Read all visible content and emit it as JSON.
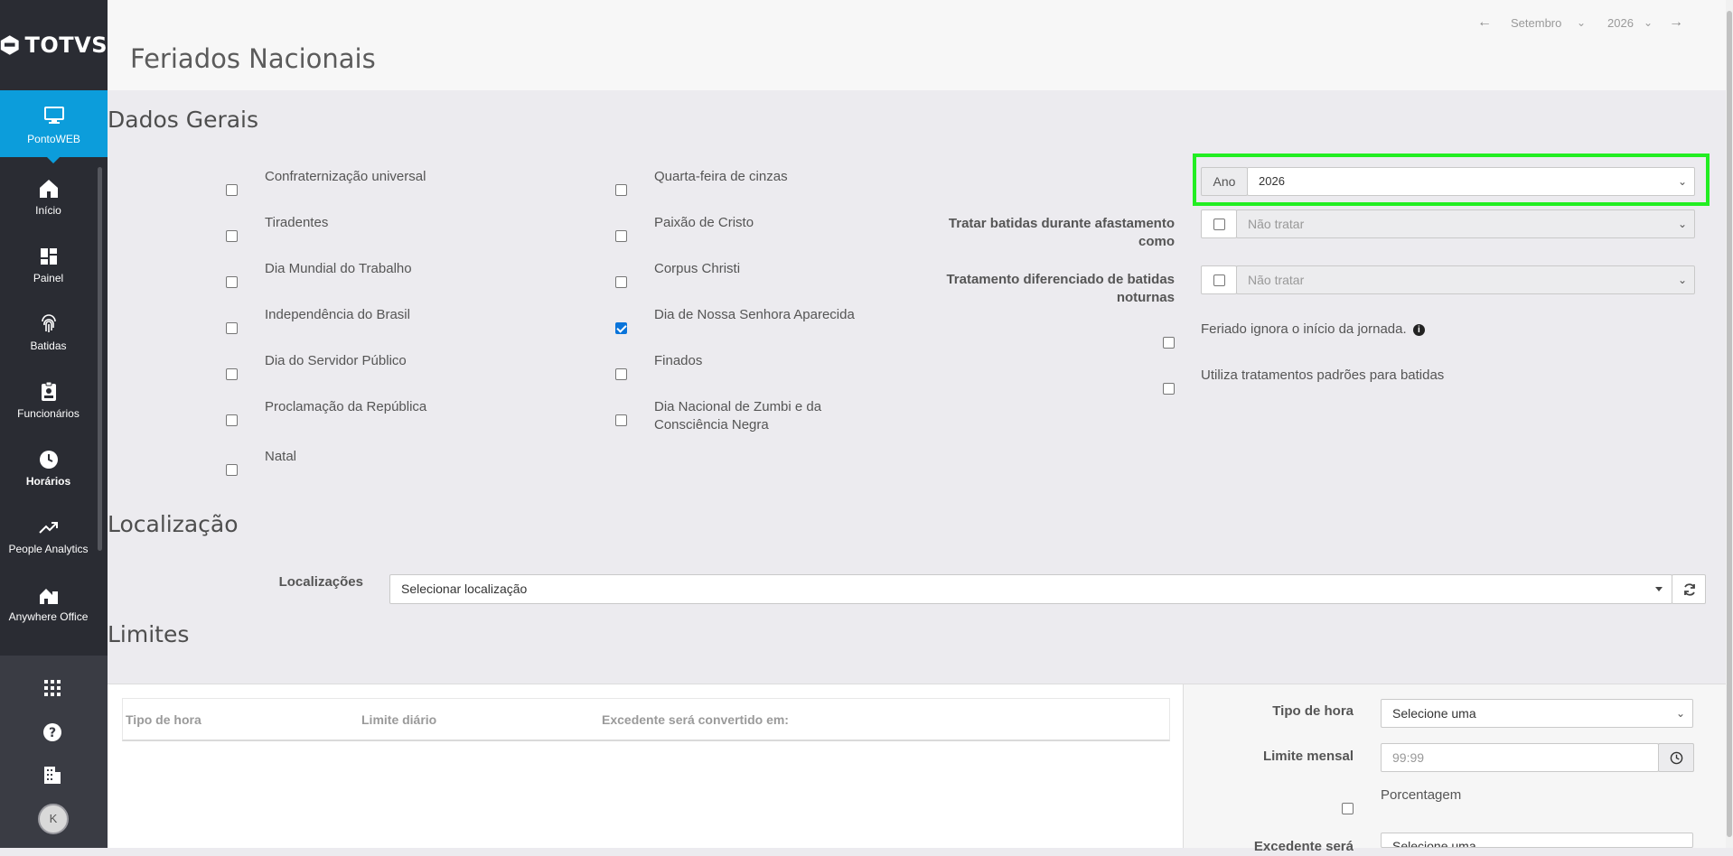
{
  "sidebar": {
    "logo": "TOTVS",
    "active": "PontoWEB",
    "items": [
      {
        "label": "Início",
        "icon": "home-icon"
      },
      {
        "label": "Painel",
        "icon": "dashboard-icon"
      },
      {
        "label": "Batidas",
        "icon": "fingerprint-icon"
      },
      {
        "label": "Funcionários",
        "icon": "id-badge-icon"
      },
      {
        "label": "Horários",
        "icon": "clock-icon"
      },
      {
        "label": "People Analytics",
        "icon": "trending-up-icon"
      },
      {
        "label": "Anywhere Office",
        "icon": "house-building-icon"
      }
    ],
    "bottom": [
      "apps-grid-icon",
      "help-icon",
      "building-icon"
    ],
    "avatar": "K"
  },
  "header": {
    "title": "Feriados Nacionais",
    "month": "Setembro",
    "year": "2026"
  },
  "dados_gerais": {
    "title": "Dados Gerais",
    "col1": [
      {
        "label": "Confraternização universal",
        "checked": false
      },
      {
        "label": "Tiradentes",
        "checked": false
      },
      {
        "label": "Dia Mundial do Trabalho",
        "checked": false
      },
      {
        "label": "Independência do Brasil",
        "checked": false
      },
      {
        "label": "Dia do Servidor Público",
        "checked": false
      },
      {
        "label": "Proclamação da República",
        "checked": false
      },
      {
        "label": "Natal",
        "checked": false
      }
    ],
    "col2": [
      {
        "label": "Quarta-feira de cinzas",
        "checked": false
      },
      {
        "label": "Paixão de Cristo",
        "checked": false
      },
      {
        "label": "Corpus Christi",
        "checked": false
      },
      {
        "label": "Dia de Nossa Senhora Aparecida",
        "checked": true
      },
      {
        "label": "Finados",
        "checked": false
      },
      {
        "label": "Dia Nacional de Zumbi e da Consciência Negra",
        "checked": false
      }
    ],
    "ano_label": "Ano",
    "ano_value": "2026",
    "tratar_afastamento_label": "Tratar batidas durante afastamento como",
    "tratar_afastamento_value": "Não tratar",
    "tratamento_noturnas_label": "Tratamento diferenciado de batidas noturnas",
    "tratamento_noturnas_value": "Não tratar",
    "ignora_jornada_label": "Feriado ignora o início da jornada.",
    "tratamentos_padroes_label": "Utiliza tratamentos padrões para batidas"
  },
  "localizacao": {
    "title": "Localização",
    "label": "Localizações",
    "placeholder": "Selecionar localização"
  },
  "limites": {
    "title": "Limites",
    "columns": [
      "Tipo de hora",
      "Limite diário",
      "Excedente será convertido em:"
    ],
    "form": {
      "tipo_hora_label": "Tipo de hora",
      "tipo_hora_value": "Selecione uma",
      "limite_mensal_label": "Limite mensal",
      "limite_mensal_placeholder": "99:99",
      "porcentagem_label": "Porcentagem",
      "excedente_label": "Excedente será",
      "excedente_value": "Selecione uma"
    }
  },
  "colors": {
    "sidebar": "#2a2c33",
    "active": "#0c9ddb",
    "highlight": "#22ee22",
    "checkbox_checked": "#0a74da"
  }
}
